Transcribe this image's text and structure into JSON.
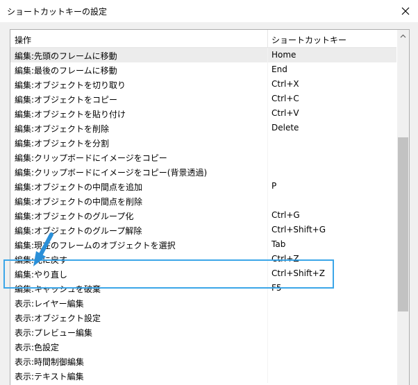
{
  "window": {
    "title": "ショートカットキーの設定",
    "close_icon": "close-icon"
  },
  "table": {
    "headers": {
      "action": "操作",
      "shortcut": "ショートカットキー"
    },
    "rows": [
      {
        "action": "編集:先頭のフレームに移動",
        "shortcut": "Home",
        "selected": true
      },
      {
        "action": "編集:最後のフレームに移動",
        "shortcut": "End"
      },
      {
        "action": "編集:オブジェクトを切り取り",
        "shortcut": "Ctrl+X"
      },
      {
        "action": "編集:オブジェクトをコピー",
        "shortcut": "Ctrl+C"
      },
      {
        "action": "編集:オブジェクトを貼り付け",
        "shortcut": "Ctrl+V"
      },
      {
        "action": "編集:オブジェクトを削除",
        "shortcut": "Delete"
      },
      {
        "action": "編集:オブジェクトを分割",
        "shortcut": ""
      },
      {
        "action": "編集:クリップボードにイメージをコピー",
        "shortcut": ""
      },
      {
        "action": "編集:クリップボードにイメージをコピー(背景透過)",
        "shortcut": ""
      },
      {
        "action": "編集:オブジェクトの中間点を追加",
        "shortcut": "P"
      },
      {
        "action": "編集:オブジェクトの中間点を削除",
        "shortcut": ""
      },
      {
        "action": "編集:オブジェクトのグループ化",
        "shortcut": "Ctrl+G"
      },
      {
        "action": "編集:オブジェクトのグループ解除",
        "shortcut": "Ctrl+Shift+G"
      },
      {
        "action": "編集:現在のフレームのオブジェクトを選択",
        "shortcut": "Tab"
      },
      {
        "action": "編集:元に戻す",
        "shortcut": "Ctrl+Z"
      },
      {
        "action": "編集:やり直し",
        "shortcut": "Ctrl+Shift+Z"
      },
      {
        "action": "編集:キャッシュを破棄",
        "shortcut": "F5"
      },
      {
        "action": "表示:レイヤー編集",
        "shortcut": ""
      },
      {
        "action": "表示:オブジェクト設定",
        "shortcut": ""
      },
      {
        "action": "表示:プレビュー編集",
        "shortcut": ""
      },
      {
        "action": "表示:色設定",
        "shortcut": ""
      },
      {
        "action": "表示:時間制御編集",
        "shortcut": ""
      },
      {
        "action": "表示:テキスト編集",
        "shortcut": ""
      }
    ]
  },
  "annotation": {
    "highlight_color": "#3ba6e8",
    "arrow_color": "#2a8fd8"
  }
}
